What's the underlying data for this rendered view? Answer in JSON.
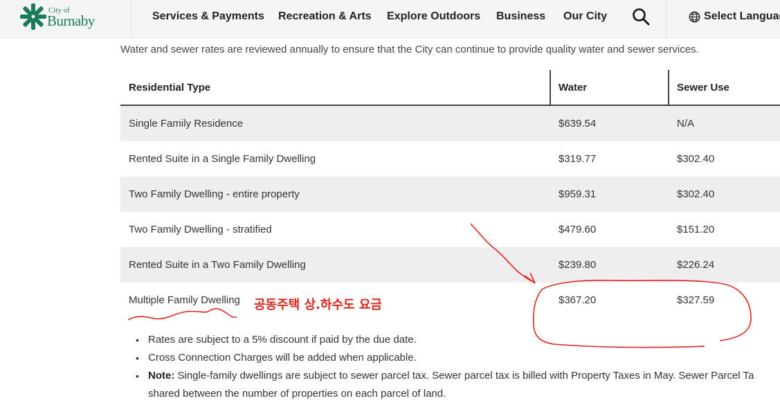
{
  "header": {
    "logo": {
      "line1": "City of",
      "line2": "Burnaby",
      "icon": "snowflake-logo-icon"
    },
    "nav": [
      "Services & Payments",
      "Recreation & Arts",
      "Explore Outdoors",
      "Business",
      "Our City"
    ],
    "search_icon": "search-icon",
    "language_icon": "globe-icon",
    "language_label": "Select Languag"
  },
  "intro": "Water and sewer rates are reviewed annually to ensure that the City can continue to provide quality water and sewer services.",
  "table": {
    "headers": [
      "Residential Type",
      "Water",
      "Sewer Use"
    ],
    "rows": [
      [
        "Single Family Residence",
        "$639.54",
        "N/A"
      ],
      [
        "Rented Suite in a Single Family Dwelling",
        "$319.77",
        "$302.40"
      ],
      [
        "Two Family Dwelling - entire property",
        "$959.31",
        "$302.40"
      ],
      [
        "Two Family Dwelling - stratified",
        "$479.60",
        "$151.20"
      ],
      [
        "Rented Suite in a Two Family Dwelling",
        "$239.80",
        "$226.24"
      ],
      [
        "Multiple Family Dwelling",
        "$367.20",
        "$327.59"
      ]
    ]
  },
  "annotation": {
    "korean_note": "공동주택 상.하수도 요금",
    "color": "#e0241f"
  },
  "bullets": {
    "items": [
      "Rates are subject to a 5% discount if paid by the due date.",
      "Cross Connection Charges will be added when applicable."
    ],
    "note_label": "Note:",
    "note_text": "Single-family dwellings are subject to sewer parcel tax. Sewer parcel tax is billed with Property Taxes in May. Sewer Parcel Ta shared between the number of properties on each parcel of land."
  },
  "colors": {
    "brand_green": "#1a7a5a",
    "row_shade": "#eeeeee",
    "header_bg": "#f5f5f5"
  }
}
